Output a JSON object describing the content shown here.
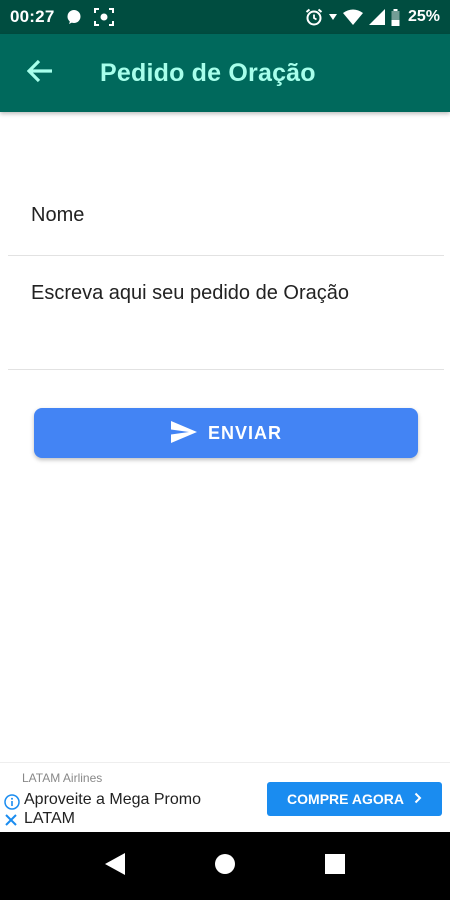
{
  "status_bar": {
    "time": "00:27",
    "battery": "25%",
    "icons": [
      "whatsapp-icon",
      "camera-focus-icon",
      "alarm-icon",
      "wifi-icon",
      "signal-icon",
      "battery-icon"
    ]
  },
  "app_bar": {
    "title": "Pedido de Oração",
    "back_icon": "arrow-back-icon"
  },
  "form": {
    "name_placeholder": "Nome",
    "request_placeholder": "Escreva aqui seu pedido de Oração",
    "send_label": "ENVIAR",
    "send_icon": "send-icon"
  },
  "ad": {
    "advertiser": "LATAM Airlines",
    "headline": "Aproveite a Mega Promo LATAM",
    "cta_label": "COMPRE AGORA"
  },
  "nav_bar": {
    "icons": [
      "back-triangle-icon",
      "home-circle-icon",
      "recents-square-icon"
    ]
  },
  "colors": {
    "status_bar": "#004D40",
    "app_bar": "#00695C",
    "title": "#A7FFEB",
    "button": "#4384F4",
    "ad_cta": "#1A8CF0"
  }
}
